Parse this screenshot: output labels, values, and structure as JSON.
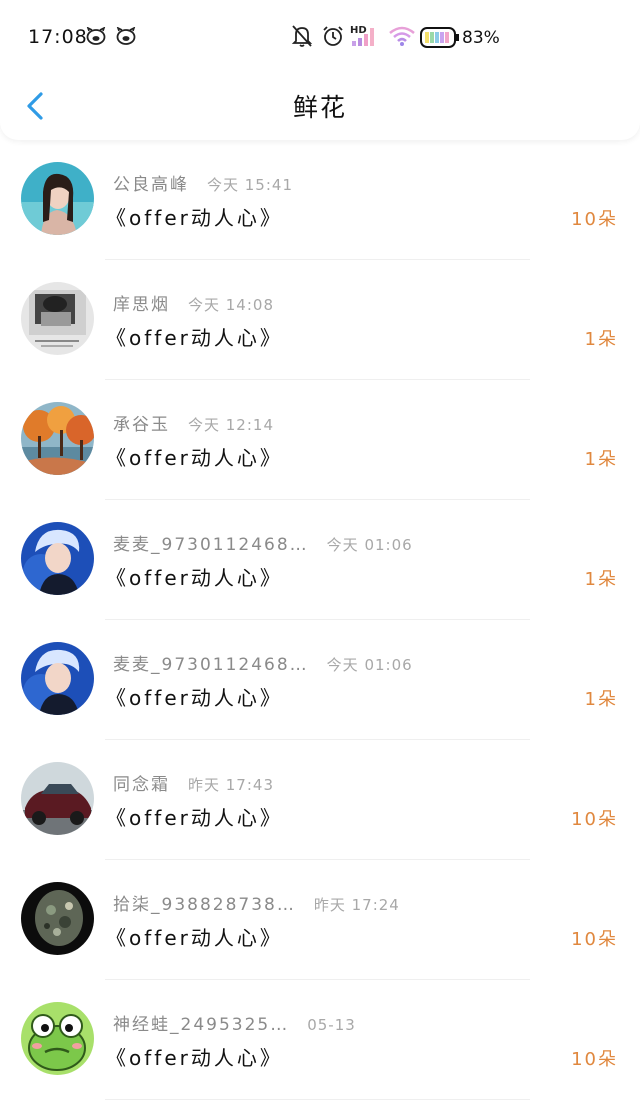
{
  "status_bar": {
    "time": "17:08",
    "battery_percent": "83%",
    "network_label": "HD"
  },
  "header": {
    "title": "鲜花"
  },
  "colors": {
    "accent": "#2f9be6",
    "count": "#e0883f"
  },
  "items": [
    {
      "name": "公良高峰",
      "time": "今天 15:41",
      "gift": "《offer动人心》",
      "count": "10朵",
      "avatar": "photo-woman"
    },
    {
      "name": "庠思烟",
      "time": "今天 14:08",
      "gift": "《offer动人心》",
      "count": "1朵",
      "avatar": "photo-grayscale"
    },
    {
      "name": "承谷玉",
      "time": "今天 12:14",
      "gift": "《offer动人心》",
      "count": "1朵",
      "avatar": "photo-autumn"
    },
    {
      "name": "麦麦_9730112468…",
      "time": "今天 01:06",
      "gift": "《offer动人心》",
      "count": "1朵",
      "avatar": "photo-singer"
    },
    {
      "name": "麦麦_9730112468…",
      "time": "今天 01:06",
      "gift": "《offer动人心》",
      "count": "1朵",
      "avatar": "photo-singer"
    },
    {
      "name": "同念霜",
      "time": "昨天 17:43",
      "gift": "《offer动人心》",
      "count": "10朵",
      "avatar": "photo-car"
    },
    {
      "name": "拾柒_938828738…",
      "time": "昨天 17:24",
      "gift": "《offer动人心》",
      "count": "10朵",
      "avatar": "photo-stone"
    },
    {
      "name": "神经蛙_2495325…",
      "time": "05-13",
      "gift": "《offer动人心》",
      "count": "10朵",
      "avatar": "frog"
    }
  ]
}
